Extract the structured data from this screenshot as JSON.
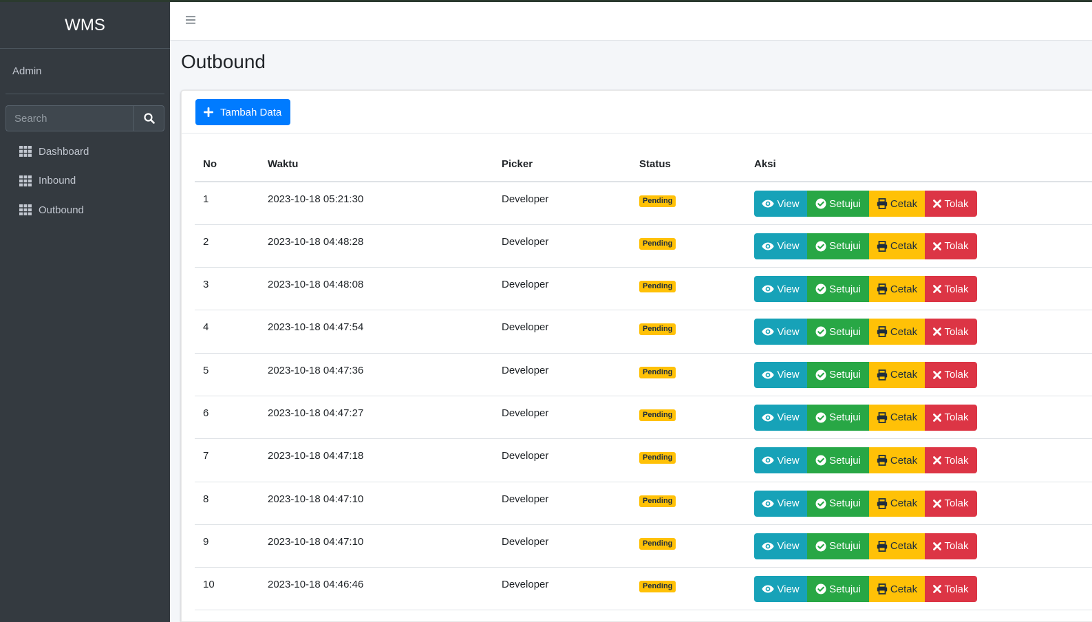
{
  "sidebar": {
    "brand": "WMS",
    "user": "Admin",
    "search_placeholder": "Search",
    "items": [
      {
        "label": "Dashboard",
        "icon": "grid-icon"
      },
      {
        "label": "Inbound",
        "icon": "grid-icon"
      },
      {
        "label": "Outbound",
        "icon": "grid-icon"
      }
    ]
  },
  "header": {
    "menu_icon": "hamburger-icon"
  },
  "page": {
    "title": "Outbound",
    "add_button": "Tambah Data"
  },
  "table": {
    "columns": [
      "No",
      "Waktu",
      "Picker",
      "Status",
      "Aksi"
    ],
    "actions": {
      "view": "View",
      "approve": "Setujui",
      "print": "Cetak",
      "reject": "Tolak"
    },
    "rows": [
      {
        "no": "1",
        "waktu": "2023-10-18 05:21:30",
        "picker": "Developer",
        "status": "Pending"
      },
      {
        "no": "2",
        "waktu": "2023-10-18 04:48:28",
        "picker": "Developer",
        "status": "Pending"
      },
      {
        "no": "3",
        "waktu": "2023-10-18 04:48:08",
        "picker": "Developer",
        "status": "Pending"
      },
      {
        "no": "4",
        "waktu": "2023-10-18 04:47:54",
        "picker": "Developer",
        "status": "Pending"
      },
      {
        "no": "5",
        "waktu": "2023-10-18 04:47:36",
        "picker": "Developer",
        "status": "Pending"
      },
      {
        "no": "6",
        "waktu": "2023-10-18 04:47:27",
        "picker": "Developer",
        "status": "Pending"
      },
      {
        "no": "7",
        "waktu": "2023-10-18 04:47:18",
        "picker": "Developer",
        "status": "Pending"
      },
      {
        "no": "8",
        "waktu": "2023-10-18 04:47:10",
        "picker": "Developer",
        "status": "Pending"
      },
      {
        "no": "9",
        "waktu": "2023-10-18 04:47:10",
        "picker": "Developer",
        "status": "Pending"
      },
      {
        "no": "10",
        "waktu": "2023-10-18 04:46:46",
        "picker": "Developer",
        "status": "Pending"
      }
    ]
  },
  "colors": {
    "sidebar_bg": "#343a40",
    "primary": "#007bff",
    "info": "#17a2b8",
    "success": "#28a745",
    "warning": "#ffc107",
    "danger": "#dc3545"
  }
}
